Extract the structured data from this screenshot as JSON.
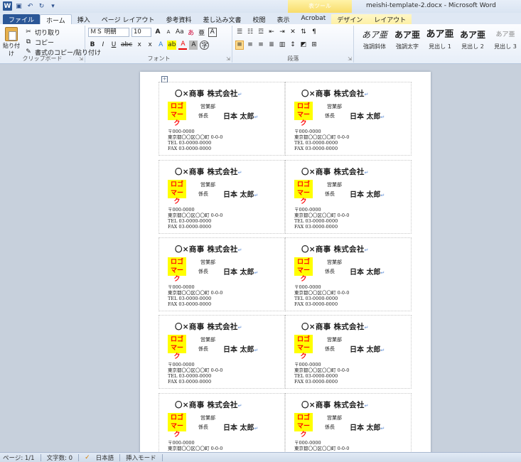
{
  "window": {
    "title": "meishi-template-2.docx - Microsoft Word",
    "context_group": "表ツール"
  },
  "qat": {
    "icons": [
      "word-icon",
      "save-icon",
      "undo-icon",
      "redo-icon",
      "customize-qat-icon"
    ]
  },
  "tabs": [
    {
      "label": "ファイル",
      "kind": "file"
    },
    {
      "label": "ホーム",
      "kind": "active"
    },
    {
      "label": "挿入",
      "kind": ""
    },
    {
      "label": "ページ レイアウト",
      "kind": ""
    },
    {
      "label": "参考資料",
      "kind": ""
    },
    {
      "label": "差し込み文書",
      "kind": ""
    },
    {
      "label": "校閲",
      "kind": ""
    },
    {
      "label": "表示",
      "kind": ""
    },
    {
      "label": "Acrobat",
      "kind": ""
    },
    {
      "label": "デザイン",
      "kind": "context"
    },
    {
      "label": "レイアウト",
      "kind": "context"
    }
  ],
  "clipboard": {
    "paste_label": "貼り付け",
    "cut_label": "切り取り",
    "copy_label": "コピー",
    "format_painter_label": "書式のコピー/貼り付け",
    "group_label": "クリップボード"
  },
  "font": {
    "font_name": "ＭＳ 明朝",
    "font_size": "10",
    "group_label": "フォント",
    "grow": "A",
    "shrink": "A",
    "case": "Aa",
    "clear": "あ",
    "phonetic": "亜",
    "border": "A",
    "bold": "B",
    "italic": "I",
    "underline": "U",
    "strike": "abc",
    "subscript": "x",
    "superscript": "x",
    "effects": "A",
    "highlight": "ab",
    "color": "A",
    "shade": "A",
    "enclose": "字"
  },
  "paragraph": {
    "group_label": "段落"
  },
  "styles": {
    "items": [
      {
        "sample": "あア亜",
        "name": "強調斜体"
      },
      {
        "sample": "あア亜",
        "name": "強調太字"
      },
      {
        "sample": "あア亜",
        "name": "見出し 1"
      },
      {
        "sample": "あア亜",
        "name": "見出し 2"
      },
      {
        "sample": "あア亜",
        "name": "見出し 3"
      }
    ]
  },
  "cards": [
    {
      "company": "〇×商事 株式会社",
      "logo_line1": "ロゴ",
      "logo_line2": "マーク",
      "dept": "営業部",
      "title": "係長",
      "name": "日本 太郎",
      "postal": "〒000-0000",
      "address": "東京都〇〇区〇〇町 0-0-0",
      "tel": "TEL 03-0000-0000",
      "fax": "FAX 03-0000-0000"
    }
  ],
  "status": {
    "page": "ページ: 1/1",
    "words": "文字数: 0",
    "language": "日本語",
    "mode": "挿入モード"
  }
}
